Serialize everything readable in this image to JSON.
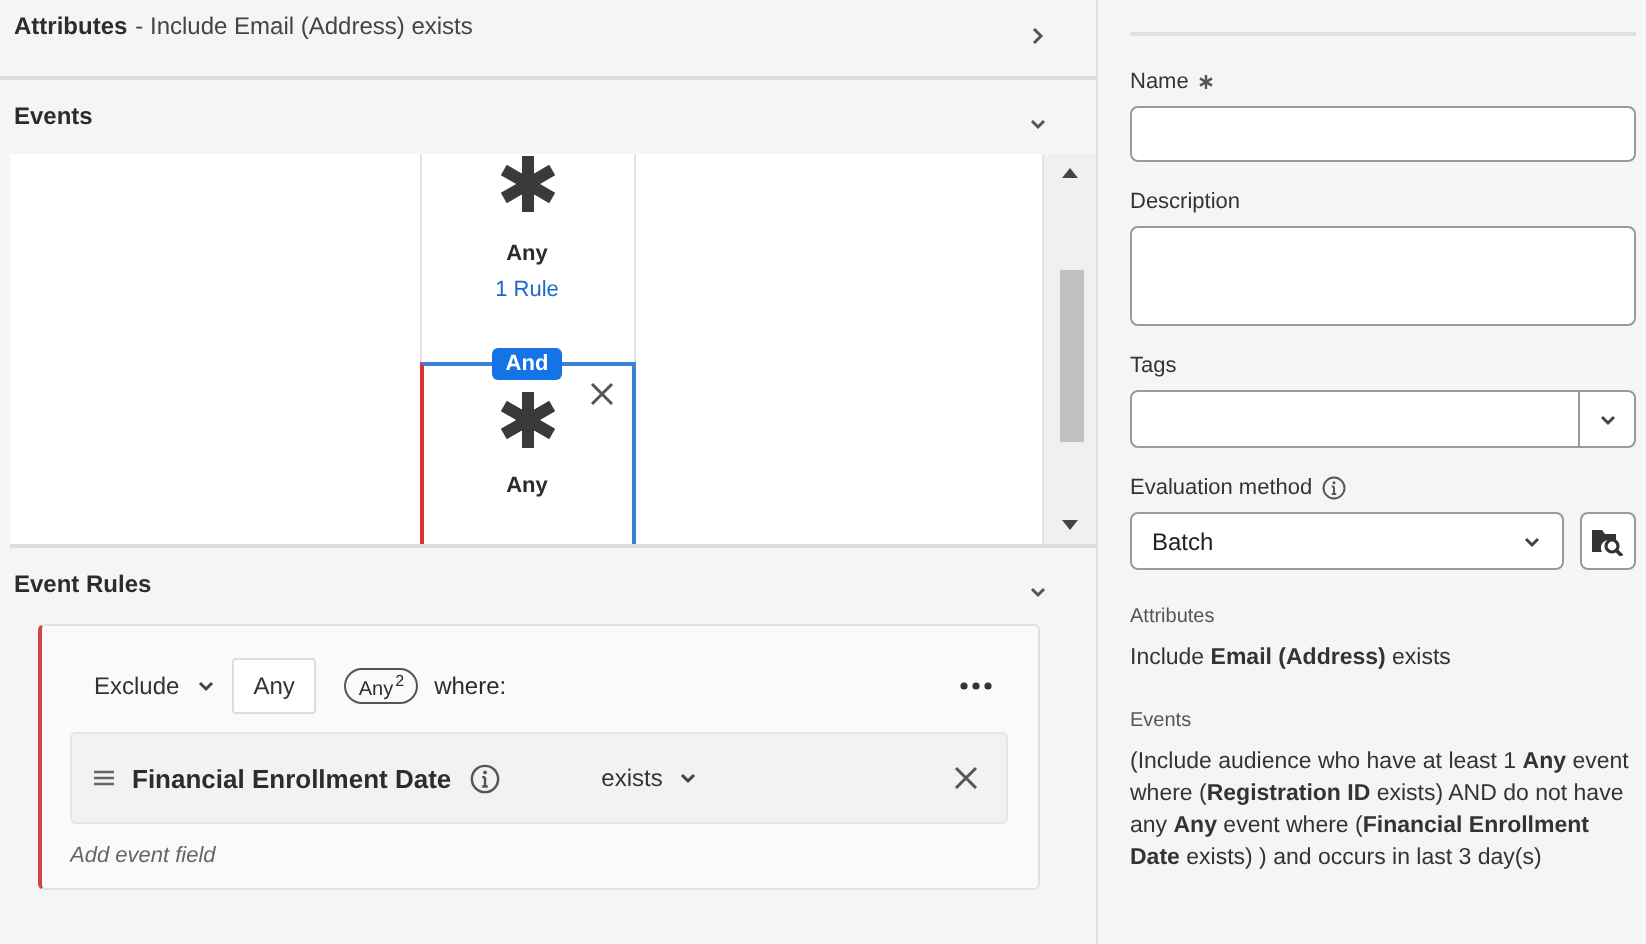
{
  "attributes_section": {
    "title": "Attributes",
    "summary": "- Include Email (Address) exists",
    "expanded": false
  },
  "events_section": {
    "title": "Events",
    "expanded": true,
    "nodes": [
      {
        "event": "Any",
        "rules": "1 Rule",
        "selected": false
      },
      {
        "connector": "And",
        "event": "Any",
        "selected": true
      }
    ]
  },
  "event_rules": {
    "title": "Event Rules",
    "expanded": true,
    "mode": "Exclude",
    "event_type": "Any",
    "badge": "Any",
    "badge_count": "2",
    "where": "where:",
    "fields": [
      {
        "name": "Financial Enrollment Date",
        "operator": "exists"
      }
    ],
    "add_field_placeholder": "Add event field"
  },
  "properties": {
    "fields": [
      {
        "label": "Name",
        "required": true,
        "kind": "text"
      },
      {
        "label": "Description",
        "kind": "textarea"
      },
      {
        "label": "Tags",
        "kind": "combo"
      },
      {
        "label": "Evaluation method",
        "info": true,
        "kind": "select",
        "value": "Batch"
      }
    ],
    "summary": [
      {
        "heading": "Attributes",
        "text": "Include **Email (Address)** exists"
      },
      {
        "heading": "Events",
        "text": "(Include audience who have at least 1 **Any** event where (**Registration ID** exists) AND do not have any **Any** event where (**Financial Enrollment Date** exists) ) and occurs in last 3 day(s)"
      }
    ]
  }
}
